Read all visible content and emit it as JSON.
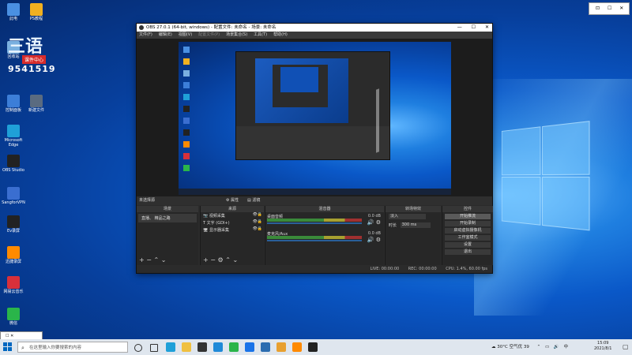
{
  "desktop": {
    "icons_left": [
      {
        "label": "此电",
        "color": "#4a90e2"
      },
      {
        "label": "PS教程",
        "color": "#f0b020"
      },
      {
        "label": "回收站",
        "color": "#7ab0e0"
      },
      {
        "label": "控制面板",
        "color": "#3c7ed8"
      },
      {
        "label": "Microsoft Edge",
        "color": "#1fa0d8"
      },
      {
        "label": "OBS Studio",
        "color": "#222222"
      },
      {
        "label": "SangforVPN",
        "color": "#3a6ed0"
      },
      {
        "label": "Ev录屏",
        "color": "#222222"
      },
      {
        "label": "迅捷录屏",
        "color": "#ff8a00"
      },
      {
        "label": "网易云音乐",
        "color": "#d8303a"
      },
      {
        "label": "微信",
        "color": "#2ab54a"
      }
    ],
    "extra_icon": {
      "label": "新建文件",
      "color": "#5a6b80"
    },
    "brand": {
      "big": "三语",
      "tag": "课件中心",
      "number": "9541519"
    }
  },
  "obs": {
    "title": "OBS 27.0.1 (64-bit, windows) - 配置文件: 未命名 - 场景: 未命名",
    "menu": [
      "文件(F)",
      "编辑(E)",
      "视图(V)",
      "配置文件(P)",
      "场景集合(S)",
      "工具(T)",
      "帮助(H)"
    ],
    "source_bar": {
      "label": "未选择源",
      "properties": "属性",
      "filters": "滤镜"
    },
    "docks": {
      "scenes": {
        "title": "场景",
        "items": [
          "直播、 精品之路"
        ]
      },
      "sources": {
        "title": "来源",
        "items": [
          {
            "icon": "📷",
            "name": "视频采集"
          },
          {
            "icon": "T",
            "name": "文字 (GDI+)"
          },
          {
            "icon": "🖥",
            "name": "显示器采集"
          }
        ]
      },
      "mixer": {
        "title": "混音器",
        "channels": [
          {
            "name": "桌面音频",
            "db": "0.0 dB"
          },
          {
            "name": "麦克风/Aux",
            "db": "0.0 dB"
          }
        ]
      },
      "transitions": {
        "title": "转场特效",
        "type": "淡入",
        "duration_label": "时长",
        "duration": "300 ms"
      },
      "controls": {
        "title": "控件",
        "buttons": [
          "开始推流",
          "开始录制",
          "启动虚拟摄像机",
          "工作室模式",
          "设置",
          "退出"
        ]
      }
    },
    "status": {
      "live": "LIVE: 00:00:00",
      "rec": "REC: 00:00:00",
      "cpu": "CPU: 1.4%, 60.00 fps"
    }
  },
  "notification": {
    "btns": [
      "⊡",
      "☐",
      "✕"
    ]
  },
  "small_window": {
    "label": "☐ ✕"
  },
  "taskbar": {
    "search_placeholder": "在这里输入你要搜索的内容",
    "weather": "30°C 空气优 39",
    "time": "15:09",
    "date": "2021/8/1",
    "lang": "中"
  },
  "colors": {
    "desktop_blue": "#0a58c8",
    "obs_bg": "#2b2b2b",
    "accent": "#0067c0"
  }
}
